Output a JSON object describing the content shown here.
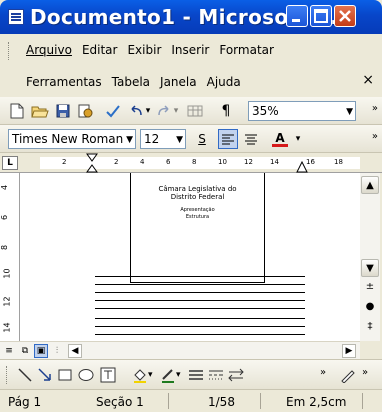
{
  "window": {
    "title": "Documento1 - Microsoft ...",
    "minimize_label": "_",
    "maximize_label": "□",
    "close_label": "×"
  },
  "menu": {
    "row1": [
      "Arquivo",
      "Editar",
      "Exibir",
      "Inserir",
      "Formatar"
    ],
    "row2": [
      "Ferramentas",
      "Tabela",
      "Janela",
      "Ajuda"
    ],
    "close_doc": "×"
  },
  "standard_toolbar": {
    "undo_arrow": "▾",
    "redo_arrow": "▾",
    "pilcrow": "¶",
    "zoom": "35%",
    "more": "»"
  },
  "format_toolbar": {
    "font": "Times New Roman",
    "size": "12",
    "underline": "S",
    "font_color": "A",
    "more": "»"
  },
  "ruler": {
    "corner": "L",
    "h_ticks": [
      "2",
      "2",
      "4",
      "6",
      "8",
      "10",
      "12",
      "14",
      "16",
      "18"
    ],
    "v_ticks": [
      "4",
      "6",
      "8",
      "10",
      "12",
      "14"
    ]
  },
  "document": {
    "line1": "Câmara Legislativa do",
    "line2": "Distrito Federal",
    "line3": "Apresentação",
    "line4": "Estrutura"
  },
  "statusbar": {
    "page": "Pág 1",
    "section": "Seção 1",
    "pages": "1/58",
    "position": "Em 2,5cm"
  },
  "colors": {
    "titlebar": "#0a5fe6",
    "chrome": "#ece9d8",
    "close_button": "#d6502b"
  }
}
